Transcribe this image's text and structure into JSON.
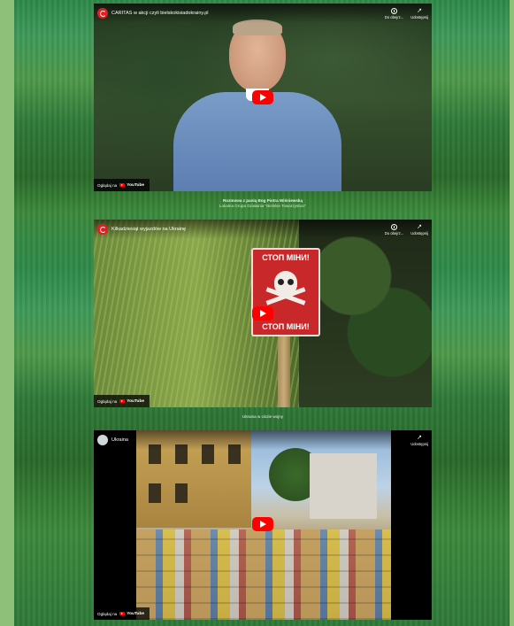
{
  "videos": [
    {
      "title": "CARITAS w akcji czyli bielskokisiadokrainy.pl",
      "watch_later": "Do obejrz...",
      "share": "Udostępnij",
      "watch_on": "Oglądaj na",
      "yt": "YouTube",
      "channel_icon": "caritas-logo-icon"
    },
    {
      "title": "Kilkadziesiąt wyjazdów na Ukrainę",
      "watch_later": "Do obejrz...",
      "share": "Udostępnij",
      "watch_on": "Oglądaj na",
      "yt": "YouTube",
      "sign_top": "СТОП МІНИ!",
      "sign_bottom": "СТОП МІНИ!",
      "channel_icon": "caritas-logo-icon"
    },
    {
      "title": "Ukraina",
      "watch_later": "",
      "share": "Udostępnij",
      "watch_on": "Oglądaj na",
      "yt": "YouTube",
      "channel_icon": "channel-avatar-icon"
    }
  ],
  "captions": {
    "first_line1": "Rozmowa z panią Bog Piotra Wiśniewską",
    "first_line2": "Lokalna Grupa Działania \"Bielskie Towarzystwo\"",
    "second": "Ukraina w ciszie wojny"
  },
  "colors": {
    "page_bg": "#8fc07a",
    "play_red": "#ff0000",
    "sign_red": "#c8282a"
  }
}
